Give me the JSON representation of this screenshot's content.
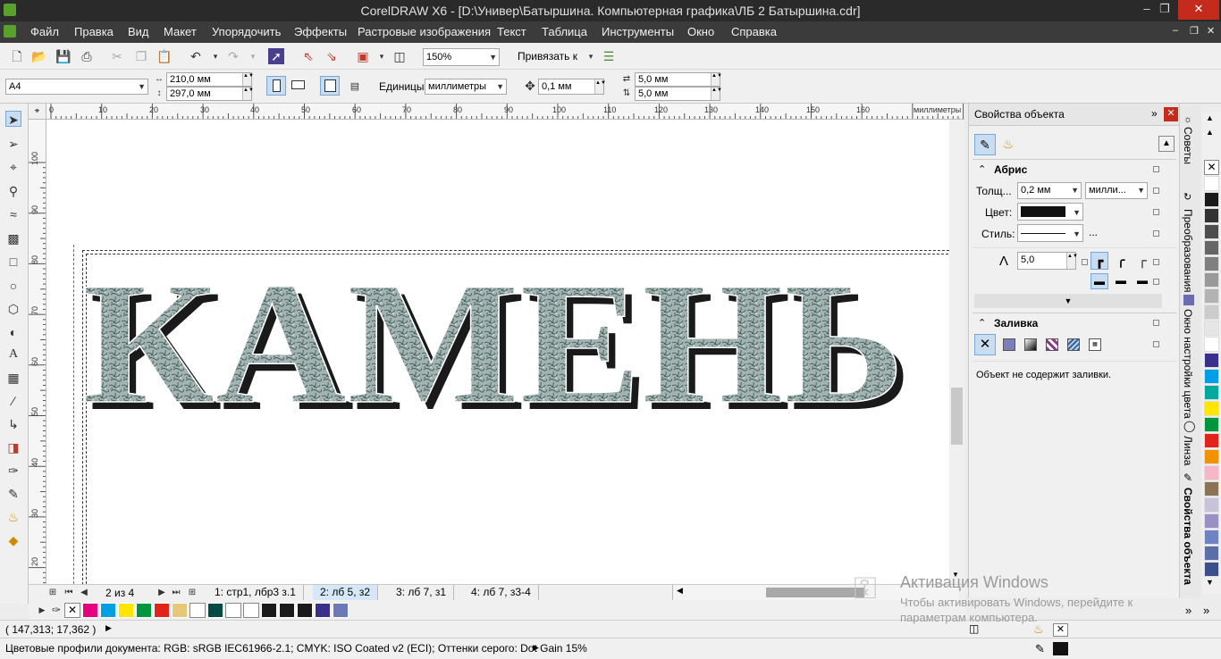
{
  "window": {
    "title": "CorelDRAW X6 - [D:\\Универ\\Батыршина. Компьютерная графика\\ЛБ 2 Батыршина.cdr]"
  },
  "menu": [
    "Файл",
    "Правка",
    "Вид",
    "Макет",
    "Упорядочить",
    "Эффекты",
    "Растровые изображения",
    "Текст",
    "Таблица",
    "Инструменты",
    "Окно",
    "Справка"
  ],
  "toolbar": {
    "zoom": "150%",
    "snap_label": "Привязать к"
  },
  "propbar": {
    "page_size": "A4",
    "width": "210,0 мм",
    "height": "297,0 мм",
    "units_label": "Единицы:",
    "units_value": "миллиметры",
    "nudge": "0,1 мм",
    "dup_x": "5,0 мм",
    "dup_y": "5,0 мм"
  },
  "ruler": {
    "h_labels": [
      "0",
      "10",
      "20",
      "30",
      "40",
      "50",
      "60",
      "70",
      "80",
      "90",
      "100",
      "110",
      "120",
      "130",
      "140",
      "150",
      "160"
    ],
    "h_unit": "миллиметры",
    "v_labels": [
      "100",
      "90",
      "80",
      "70",
      "60",
      "50",
      "40",
      "30",
      "20"
    ],
    "v_unit": "миллиметры"
  },
  "canvas": {
    "text": "КАМЕНЬ"
  },
  "pages": {
    "counter": "2 из 4",
    "tabs": [
      "1: стр1, лбр3 з.1",
      "2: лб 5, з2",
      "3: лб 7, з1",
      "4: лб 7, з3-4"
    ],
    "active": 1
  },
  "status": {
    "coords": "( 147,313; 17,362 )",
    "profiles": "Цветовые профили документа: RGB: sRGB IEC61966-2.1; CMYK: ISO Coated v2 (ECI); Оттенки серого: Dot Gain 15%"
  },
  "docker": {
    "title": "Свойства объекта",
    "outline": {
      "heading": "Абрис",
      "width_label": "Толщ...",
      "width_value": "0,2 мм",
      "width_unit": "милли...",
      "color_label": "Цвет:",
      "style_label": "Стиль:",
      "more": "...",
      "miter_value": "5,0"
    },
    "fill": {
      "heading": "Заливка",
      "note": "Объект не содержит заливки."
    }
  },
  "sidetabs": [
    "Советы",
    "Преобразования",
    "Окно настройки цвета",
    "Линза",
    "Свойства объекта"
  ],
  "activation": {
    "title": "Активация Windows",
    "line1": "Чтобы активировать Windows, перейдите к",
    "line2": "параметрам компьютера."
  },
  "colors": {
    "bottom_palette": [
      "#e5007e",
      "#00a0e2",
      "#ffe500",
      "#00963f",
      "#e2231a",
      "#e6c878",
      "#ffffff",
      "#004a45",
      "#ffffff",
      "#ffffff",
      "#1a1a1a",
      "#1a1a1a",
      "#1a1a1a",
      "#3a2f8a",
      "#6c7ab5"
    ],
    "right_palette": [
      "#ffffff",
      "#1a1a1a",
      "#333333",
      "#4d4d4d",
      "#666666",
      "#808080",
      "#999999",
      "#b3b3b3",
      "#cccccc",
      "#e6e6e6",
      "#ffffff",
      "#3a2f8a",
      "#009ee3",
      "#00a99d",
      "#ffe500",
      "#00963f",
      "#e2231a",
      "#f39200",
      "#f5b6c8",
      "#8b7355",
      "#c8c3d9",
      "#9a90c6",
      "#6e82c4",
      "#5a6fa8",
      "#3d4f8a"
    ],
    "stone": "#9aaaa8",
    "shadow": "#1a1a1a"
  }
}
